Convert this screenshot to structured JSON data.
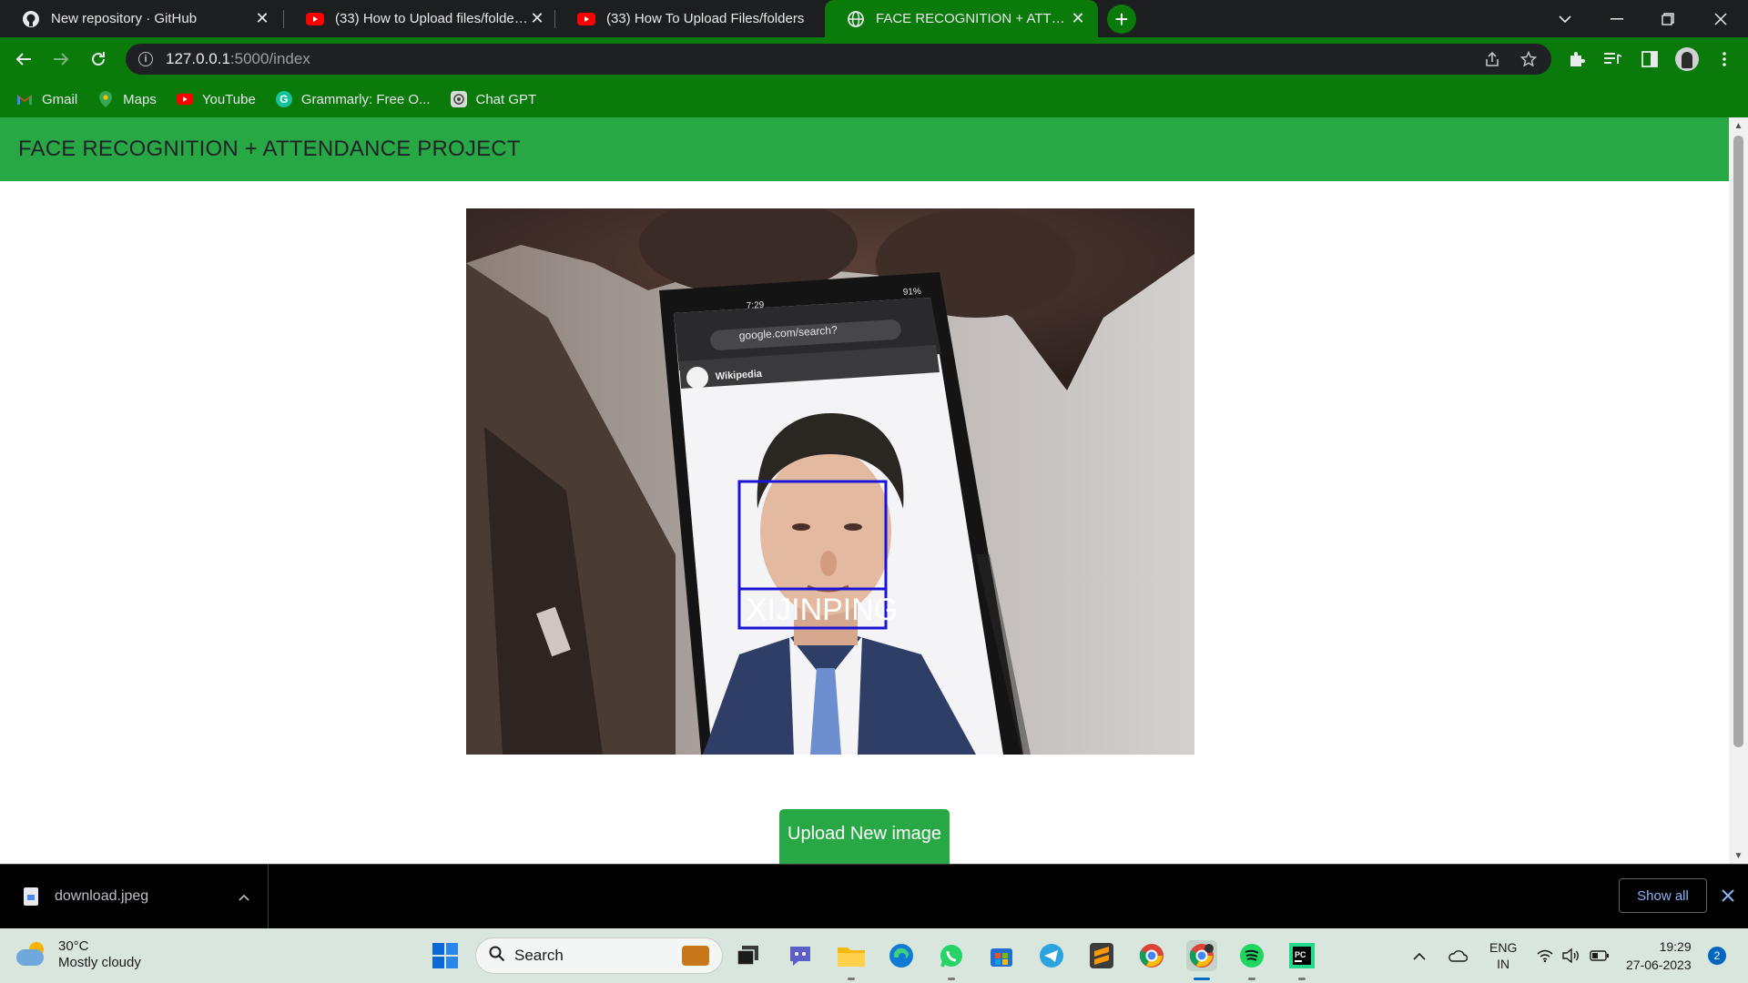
{
  "browser": {
    "tabs": [
      {
        "title": "New repository · GitHub",
        "icon": "github-icon",
        "active": false
      },
      {
        "title": "(33) How to Upload files/folders/",
        "icon": "youtube-icon",
        "active": false
      },
      {
        "title": "(33) How To Upload Files/folders",
        "icon": "youtube-icon",
        "active": false
      },
      {
        "title": "FACE RECOGNITION + ATTENDANCE",
        "icon": "globe-icon",
        "active": true
      }
    ],
    "url_host": "127.0.0.1",
    "url_path": ":5000/index",
    "bookmarks": [
      {
        "label": "Gmail",
        "icon": "gmail-icon"
      },
      {
        "label": "Maps",
        "icon": "maps-icon"
      },
      {
        "label": "YouTube",
        "icon": "youtube-icon"
      },
      {
        "label": "Grammarly: Free O...",
        "icon": "grammarly-icon"
      },
      {
        "label": "Chat GPT",
        "icon": "chatgpt-icon"
      }
    ]
  },
  "page": {
    "header_title": "FACE RECOGNITION + ATTENDANCE PROJECT",
    "photo": {
      "detected_name": "XIJINPING",
      "phone_url": "google.com/search?",
      "phone_time": "7:29",
      "phone_battery": "91%",
      "phone_card_title": "Wikipedia"
    },
    "upload_button": "Upload New image"
  },
  "downloads": {
    "file_name": "download.jpeg",
    "show_all": "Show all"
  },
  "taskbar": {
    "weather_temp": "30°C",
    "weather_desc": "Mostly cloudy",
    "search_label": "Search",
    "lang_line1": "ENG",
    "lang_line2": "IN",
    "time": "19:29",
    "date": "27-06-2023",
    "notification_count": "2"
  },
  "colors": {
    "header_green": "#28a745",
    "chrome_green": "#0a7a0a",
    "detection_box": "#1a14d4"
  }
}
